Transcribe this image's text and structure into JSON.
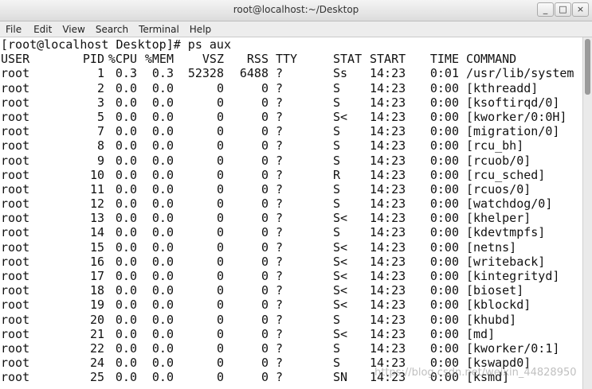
{
  "window": {
    "title": "root@localhost:~/Desktop",
    "minimize_label": "_",
    "maximize_label": "□",
    "close_label": "×"
  },
  "menubar": {
    "items": [
      "File",
      "Edit",
      "View",
      "Search",
      "Terminal",
      "Help"
    ]
  },
  "terminal": {
    "prompt": "[root@localhost Desktop]# ps aux",
    "header": {
      "user": "USER",
      "pid": "PID",
      "cpu": "%CPU",
      "mem": "%MEM",
      "vsz": "VSZ",
      "rss": "RSS",
      "tty": "TTY",
      "stat": "STAT",
      "start": "START",
      "time": "TIME",
      "command": "COMMAND"
    },
    "rows": [
      {
        "user": "root",
        "pid": "1",
        "cpu": "0.3",
        "mem": "0.3",
        "vsz": "52328",
        "rss": "6488",
        "tty": "?",
        "stat": "Ss",
        "start": "14:23",
        "time": "0:01",
        "command": "/usr/lib/system"
      },
      {
        "user": "root",
        "pid": "2",
        "cpu": "0.0",
        "mem": "0.0",
        "vsz": "0",
        "rss": "0",
        "tty": "?",
        "stat": "S",
        "start": "14:23",
        "time": "0:00",
        "command": "[kthreadd]"
      },
      {
        "user": "root",
        "pid": "3",
        "cpu": "0.0",
        "mem": "0.0",
        "vsz": "0",
        "rss": "0",
        "tty": "?",
        "stat": "S",
        "start": "14:23",
        "time": "0:00",
        "command": "[ksoftirqd/0]"
      },
      {
        "user": "root",
        "pid": "5",
        "cpu": "0.0",
        "mem": "0.0",
        "vsz": "0",
        "rss": "0",
        "tty": "?",
        "stat": "S<",
        "start": "14:23",
        "time": "0:00",
        "command": "[kworker/0:0H]"
      },
      {
        "user": "root",
        "pid": "7",
        "cpu": "0.0",
        "mem": "0.0",
        "vsz": "0",
        "rss": "0",
        "tty": "?",
        "stat": "S",
        "start": "14:23",
        "time": "0:00",
        "command": "[migration/0]"
      },
      {
        "user": "root",
        "pid": "8",
        "cpu": "0.0",
        "mem": "0.0",
        "vsz": "0",
        "rss": "0",
        "tty": "?",
        "stat": "S",
        "start": "14:23",
        "time": "0:00",
        "command": "[rcu_bh]"
      },
      {
        "user": "root",
        "pid": "9",
        "cpu": "0.0",
        "mem": "0.0",
        "vsz": "0",
        "rss": "0",
        "tty": "?",
        "stat": "S",
        "start": "14:23",
        "time": "0:00",
        "command": "[rcuob/0]"
      },
      {
        "user": "root",
        "pid": "10",
        "cpu": "0.0",
        "mem": "0.0",
        "vsz": "0",
        "rss": "0",
        "tty": "?",
        "stat": "R",
        "start": "14:23",
        "time": "0:00",
        "command": "[rcu_sched]"
      },
      {
        "user": "root",
        "pid": "11",
        "cpu": "0.0",
        "mem": "0.0",
        "vsz": "0",
        "rss": "0",
        "tty": "?",
        "stat": "S",
        "start": "14:23",
        "time": "0:00",
        "command": "[rcuos/0]"
      },
      {
        "user": "root",
        "pid": "12",
        "cpu": "0.0",
        "mem": "0.0",
        "vsz": "0",
        "rss": "0",
        "tty": "?",
        "stat": "S",
        "start": "14:23",
        "time": "0:00",
        "command": "[watchdog/0]"
      },
      {
        "user": "root",
        "pid": "13",
        "cpu": "0.0",
        "mem": "0.0",
        "vsz": "0",
        "rss": "0",
        "tty": "?",
        "stat": "S<",
        "start": "14:23",
        "time": "0:00",
        "command": "[khelper]"
      },
      {
        "user": "root",
        "pid": "14",
        "cpu": "0.0",
        "mem": "0.0",
        "vsz": "0",
        "rss": "0",
        "tty": "?",
        "stat": "S",
        "start": "14:23",
        "time": "0:00",
        "command": "[kdevtmpfs]"
      },
      {
        "user": "root",
        "pid": "15",
        "cpu": "0.0",
        "mem": "0.0",
        "vsz": "0",
        "rss": "0",
        "tty": "?",
        "stat": "S<",
        "start": "14:23",
        "time": "0:00",
        "command": "[netns]"
      },
      {
        "user": "root",
        "pid": "16",
        "cpu": "0.0",
        "mem": "0.0",
        "vsz": "0",
        "rss": "0",
        "tty": "?",
        "stat": "S<",
        "start": "14:23",
        "time": "0:00",
        "command": "[writeback]"
      },
      {
        "user": "root",
        "pid": "17",
        "cpu": "0.0",
        "mem": "0.0",
        "vsz": "0",
        "rss": "0",
        "tty": "?",
        "stat": "S<",
        "start": "14:23",
        "time": "0:00",
        "command": "[kintegrityd]"
      },
      {
        "user": "root",
        "pid": "18",
        "cpu": "0.0",
        "mem": "0.0",
        "vsz": "0",
        "rss": "0",
        "tty": "?",
        "stat": "S<",
        "start": "14:23",
        "time": "0:00",
        "command": "[bioset]"
      },
      {
        "user": "root",
        "pid": "19",
        "cpu": "0.0",
        "mem": "0.0",
        "vsz": "0",
        "rss": "0",
        "tty": "?",
        "stat": "S<",
        "start": "14:23",
        "time": "0:00",
        "command": "[kblockd]"
      },
      {
        "user": "root",
        "pid": "20",
        "cpu": "0.0",
        "mem": "0.0",
        "vsz": "0",
        "rss": "0",
        "tty": "?",
        "stat": "S",
        "start": "14:23",
        "time": "0:00",
        "command": "[khubd]"
      },
      {
        "user": "root",
        "pid": "21",
        "cpu": "0.0",
        "mem": "0.0",
        "vsz": "0",
        "rss": "0",
        "tty": "?",
        "stat": "S<",
        "start": "14:23",
        "time": "0:00",
        "command": "[md]"
      },
      {
        "user": "root",
        "pid": "22",
        "cpu": "0.0",
        "mem": "0.0",
        "vsz": "0",
        "rss": "0",
        "tty": "?",
        "stat": "S",
        "start": "14:23",
        "time": "0:00",
        "command": "[kworker/0:1]"
      },
      {
        "user": "root",
        "pid": "24",
        "cpu": "0.0",
        "mem": "0.0",
        "vsz": "0",
        "rss": "0",
        "tty": "?",
        "stat": "S",
        "start": "14:23",
        "time": "0:00",
        "command": "[kswapd0]"
      },
      {
        "user": "root",
        "pid": "25",
        "cpu": "0.0",
        "mem": "0.0",
        "vsz": "0",
        "rss": "0",
        "tty": "?",
        "stat": "SN",
        "start": "14:23",
        "time": "0:00",
        "command": "[ksmd]"
      }
    ]
  },
  "watermark": "https://blog.csdn.net/weixin_44828950"
}
